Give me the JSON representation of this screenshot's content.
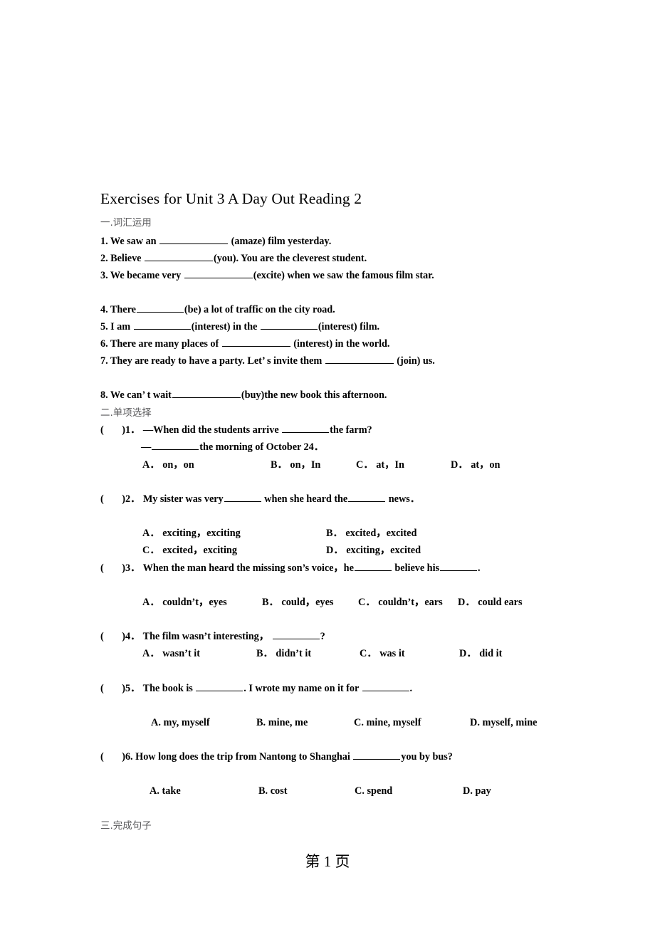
{
  "document": {
    "title": "Exercises for Unit 3 A Day Out Reading 2",
    "footer": "第 1 页"
  },
  "sections": {
    "one": {
      "heading": "一.词汇运用"
    },
    "two": {
      "heading": "二.单项选择"
    },
    "three": {
      "heading": "三.完成句子"
    }
  },
  "vocabulary": {
    "q1": {
      "pre": "1. We saw an",
      "post": "(amaze) film yesterday."
    },
    "q2": {
      "pre": "2. Believe",
      "post": "(you). You are the cleverest student."
    },
    "q3": {
      "pre": "3. We became very",
      "post": "(excite) when we saw the famous film star."
    },
    "q4": {
      "pre": "4. There",
      "post": "(be) a lot of traffic on the city road."
    },
    "q5": {
      "pre": "5. I am",
      "mid": "(interest) in the",
      "post": "(interest) film."
    },
    "q6": {
      "pre": "6. There are many places of",
      "post": "(interest) in the world."
    },
    "q7": {
      "pre": "7. They are ready to have a party. Let’ s invite them",
      "post": "(join) us."
    },
    "q8": {
      "pre": "8. We can’ t wait",
      "post": "(buy)the new book this afternoon."
    }
  },
  "multiple_choice": [
    {
      "number": ")1．",
      "bracket": "(",
      "stem_pre": "—When did the students arrive",
      "stem_post": "the farm?",
      "stem2_pre": "—",
      "stem2_post": "the morning of October 24．",
      "options": [
        {
          "label": "A．",
          "text": "on，on"
        },
        {
          "label": "B．",
          "text": "on，In"
        },
        {
          "label": "C．",
          "text": "at，In"
        },
        {
          "label": "D．",
          "text": "at，on"
        }
      ]
    },
    {
      "number": ")2．",
      "bracket": "(",
      "stem_pre": "My sister was very",
      "stem_mid": "when she heard the",
      "stem_post": "news．",
      "options": [
        {
          "label": "A．",
          "text": "exciting，exciting"
        },
        {
          "label": "B．",
          "text": "excited，excited"
        },
        {
          "label": "C．",
          "text": "excited，exciting"
        },
        {
          "label": "D．",
          "text": "exciting，excited"
        }
      ]
    },
    {
      "number": ")3．",
      "bracket": "(",
      "stem_pre": "When the man heard the missing son’s voice，he",
      "stem_mid": "believe his",
      "stem_post": ".",
      "options": [
        {
          "label": "A．",
          "text": "couldn’t，eyes"
        },
        {
          "label": "B．",
          "text": "could，eyes"
        },
        {
          "label": "C．",
          "text": "couldn’t，ears"
        },
        {
          "label": "D．",
          "text": "could ears"
        }
      ]
    },
    {
      "number": ")4．",
      "bracket": "(",
      "stem_pre": "The film wasn’t interesting，",
      "stem_post": "?",
      "options": [
        {
          "label": "A．",
          "text": "wasn’t it"
        },
        {
          "label": "B．",
          "text": "didn’t it"
        },
        {
          "label": "C．",
          "text": "was it"
        },
        {
          "label": "D．",
          "text": "did it"
        }
      ]
    },
    {
      "number": ")5．",
      "bracket": "(",
      "stem_pre": "The book is",
      "stem_mid": ". I wrote my name on it for",
      "stem_post": ".",
      "options": [
        {
          "label": "A.",
          "text": "my, myself"
        },
        {
          "label": "B.",
          "text": "mine, me"
        },
        {
          "label": "C.",
          "text": "mine, myself"
        },
        {
          "label": "D.",
          "text": "myself, mine"
        }
      ]
    },
    {
      "number": ")6.",
      "bracket": "(",
      "stem_pre": "How long does the trip from Nantong to Shanghai",
      "stem_post": "you by bus?",
      "options": [
        {
          "label": "A.",
          "text": "take"
        },
        {
          "label": "B.",
          "text": "cost"
        },
        {
          "label": "C.",
          "text": "spend"
        },
        {
          "label": "D.",
          "text": "pay"
        }
      ]
    }
  ]
}
